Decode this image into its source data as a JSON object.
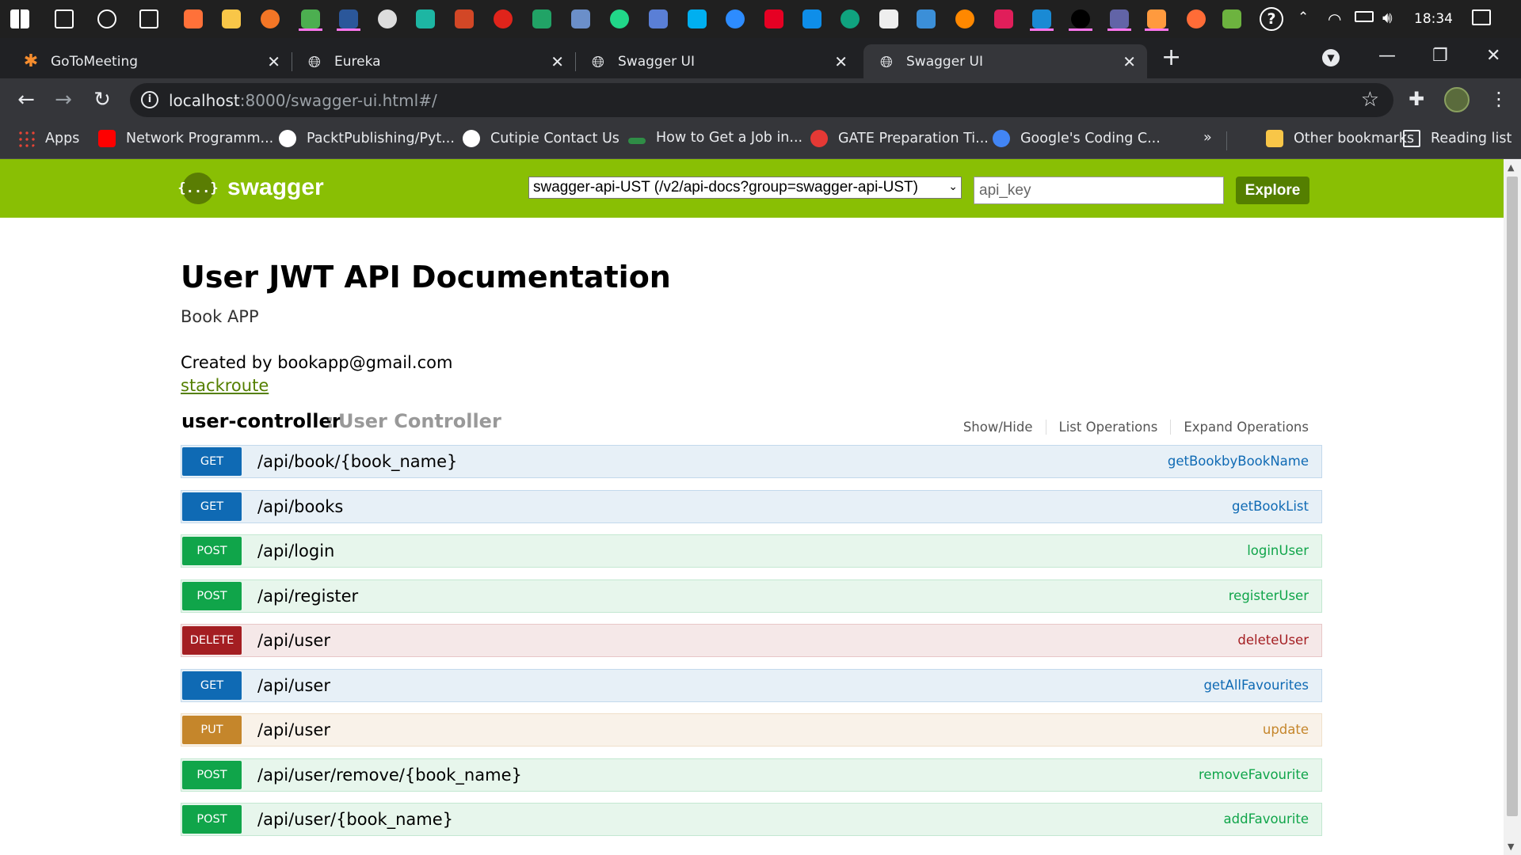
{
  "taskbar": {
    "clock": "18:34",
    "icons": [
      {
        "name": "start-icon",
        "color": "#ffffff"
      },
      {
        "name": "search-icon",
        "color": "#ffffff"
      },
      {
        "name": "cortana-icon",
        "color": "#ffffff"
      },
      {
        "name": "task-view-icon",
        "color": "#ffffff"
      },
      {
        "name": "firefox-icon",
        "color": "#ff7139"
      },
      {
        "name": "file-explorer-icon",
        "color": "#f8c648"
      },
      {
        "name": "jupyter-icon",
        "color": "#f37626"
      },
      {
        "name": "chrome-icon",
        "color": "#4caf50"
      },
      {
        "name": "word-icon",
        "color": "#2b579a"
      },
      {
        "name": "store-icon",
        "color": "#dddddd"
      },
      {
        "name": "edge-icon",
        "color": "#1db6a3"
      },
      {
        "name": "powerpoint-icon",
        "color": "#d24726"
      },
      {
        "name": "acrobat-icon",
        "color": "#e0241b"
      },
      {
        "name": "excel-icon",
        "color": "#21a366"
      },
      {
        "name": "r-icon",
        "color": "#6b8fc9"
      },
      {
        "name": "pycharm-icon",
        "color": "#21d789"
      },
      {
        "name": "remote-desktop-icon",
        "color": "#5a7fd6"
      },
      {
        "name": "skype-icon",
        "color": "#00aff0"
      },
      {
        "name": "zoom-icon",
        "color": "#2d8cff"
      },
      {
        "name": "pinterest-icon",
        "color": "#e60023"
      },
      {
        "name": "teamviewer-icon",
        "color": "#0e8ee9"
      },
      {
        "name": "chatgpt-icon",
        "color": "#10a37f"
      },
      {
        "name": "inkscape-icon",
        "color": "#eeeeee"
      },
      {
        "name": "virtualbox-icon",
        "color": "#3b8fd8"
      },
      {
        "name": "vlc-icon",
        "color": "#ff8800"
      },
      {
        "name": "slack-icon",
        "color": "#e01e5a"
      },
      {
        "name": "mail-icon",
        "color": "#1a8ad4"
      },
      {
        "name": "intellij-icon",
        "color": "#000000"
      },
      {
        "name": "teams-icon",
        "color": "#6264a7"
      },
      {
        "name": "snipping-icon",
        "color": "#ff9a3e"
      },
      {
        "name": "postman-icon",
        "color": "#ff6c37"
      },
      {
        "name": "sts-icon",
        "color": "#6db33f"
      }
    ]
  },
  "tabs": [
    {
      "title": "GoToMeeting",
      "icon": "gotomeeting-icon",
      "active": false
    },
    {
      "title": "Eureka",
      "icon": "globe-icon",
      "active": false
    },
    {
      "title": "Swagger UI",
      "icon": "globe-icon",
      "active": false
    },
    {
      "title": "Swagger UI",
      "icon": "globe-icon",
      "active": true
    }
  ],
  "address_bar": {
    "host": "localhost",
    "rest": ":8000/swagger-ui.html#/"
  },
  "bookmarks": [
    {
      "label": "Apps",
      "icon": "apps-grid-icon",
      "color": "#4285f4"
    },
    {
      "label": "Network Programm...",
      "icon": "youtube-icon",
      "color": "#ff0000"
    },
    {
      "label": "PacktPublishing/Pyt...",
      "icon": "github-icon",
      "color": "#ffffff"
    },
    {
      "label": "Cutipie Contact Us",
      "icon": "globe-icon",
      "color": "#ffffff"
    },
    {
      "label": "How to Get a Job in...",
      "icon": "link-icon",
      "color": "#2f8d46"
    },
    {
      "label": "GATE Preparation Ti...",
      "icon": "gate-icon",
      "color": "#e53935"
    },
    {
      "label": "Google's Coding C...",
      "icon": "google-icon",
      "color": "#4285f4"
    }
  ],
  "bookmarks_right": {
    "overflow": "»",
    "other": "Other bookmarks",
    "reading": "Reading list"
  },
  "swagger": {
    "brand": "swagger",
    "logo_text": "{...}",
    "api_select": "swagger-api-UST (/v2/api-docs?group=swagger-api-UST)",
    "api_key_placeholder": "api_key",
    "explore": "Explore",
    "accent": "#89bf04"
  },
  "info": {
    "title": "User JWT API Documentation",
    "description": "Book APP",
    "created_by": "Created by bookapp@gmail.com",
    "link": "stackroute"
  },
  "controller": {
    "name": "user-controller",
    "separator": ":",
    "description": "User Controller",
    "links": [
      "Show/Hide",
      "List Operations",
      "Expand Operations"
    ],
    "operations": [
      {
        "method": "GET",
        "path": "/api/book/{book_name}",
        "nickname": "getBookbyBookName"
      },
      {
        "method": "GET",
        "path": "/api/books",
        "nickname": "getBookList"
      },
      {
        "method": "POST",
        "path": "/api/login",
        "nickname": "loginUser"
      },
      {
        "method": "POST",
        "path": "/api/register",
        "nickname": "registerUser"
      },
      {
        "method": "DELETE",
        "path": "/api/user",
        "nickname": "deleteUser"
      },
      {
        "method": "GET",
        "path": "/api/user",
        "nickname": "getAllFavourites"
      },
      {
        "method": "PUT",
        "path": "/api/user",
        "nickname": "update"
      },
      {
        "method": "POST",
        "path": "/api/user/remove/{book_name}",
        "nickname": "removeFavourite"
      },
      {
        "method": "POST",
        "path": "/api/user/{book_name}",
        "nickname": "addFavourite"
      }
    ]
  }
}
